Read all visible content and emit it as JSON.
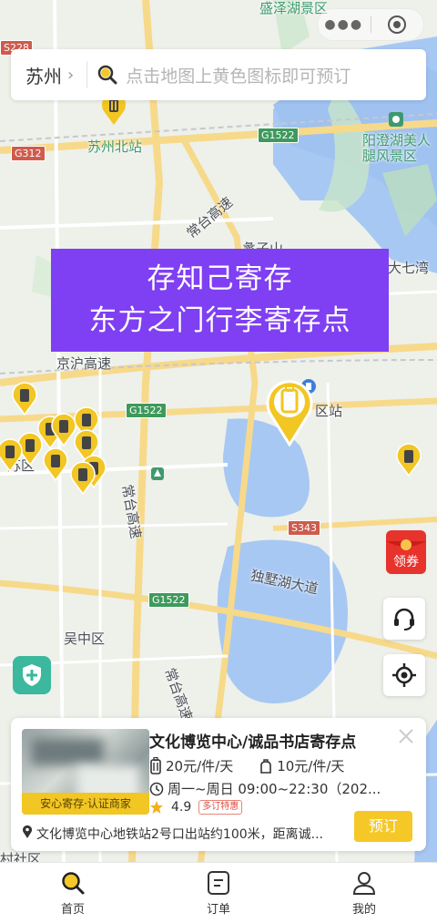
{
  "top_capsule": {
    "more_icon": "more-dots-icon",
    "close_icon": "target-circle-icon"
  },
  "search": {
    "city": "苏州",
    "placeholder": "点击地图上黄色图标即可预订"
  },
  "banner": {
    "line1": "存知己寄存",
    "line2": "东方之门行李寄存点"
  },
  "map": {
    "labels": [
      {
        "text": "盛泽湖景区",
        "kind": "green"
      },
      {
        "text": "苏州北站",
        "kind": "green"
      },
      {
        "text": "阳澄湖美人腿风景区",
        "kind": "green"
      },
      {
        "text": "常台高速",
        "kind": "normal"
      },
      {
        "text": "蠡子山",
        "kind": "normal"
      },
      {
        "text": "大七湾",
        "kind": "normal"
      },
      {
        "text": "京沪高速",
        "kind": "normal"
      },
      {
        "text": "区站",
        "kind": "normal"
      },
      {
        "text": "苏区",
        "kind": "normal"
      },
      {
        "text": "常台高速",
        "kind": "normal"
      },
      {
        "text": "独墅湖大道",
        "kind": "normal"
      },
      {
        "text": "吴中区",
        "kind": "normal"
      },
      {
        "text": "常台高速",
        "kind": "normal"
      },
      {
        "text": "村社区",
        "kind": "normal"
      }
    ],
    "shields": [
      "G312",
      "G1522",
      "G1522",
      "S343",
      "G1522",
      "S228"
    ]
  },
  "side_buttons": {
    "service_icon": "headset-icon",
    "locate_icon": "locate-icon",
    "shield_icon": "shield-plus-icon",
    "red_packet_label": "领券"
  },
  "card": {
    "title": "文化博览中心/诚品书店寄存点",
    "thumb_tag": "安心寄存·认证商家",
    "price_large": "20元/件/天",
    "price_small": "10元/件/天",
    "hours": "周一~周日 09:00~22:30（202...",
    "rating": "4.9",
    "sale_tag": "多订特惠",
    "address": "文化博览中心地铁站2号口出站约100米，距离诚...",
    "book_label": "预订"
  },
  "tabs": [
    {
      "label": "首页",
      "icon": "search-home-icon",
      "active": true
    },
    {
      "label": "订单",
      "icon": "order-icon",
      "active": false
    },
    {
      "label": "我的",
      "icon": "profile-icon",
      "active": false
    }
  ],
  "colors": {
    "accent": "#f5c828",
    "banner": "#7f3ff2",
    "pin": "#f2c623"
  }
}
